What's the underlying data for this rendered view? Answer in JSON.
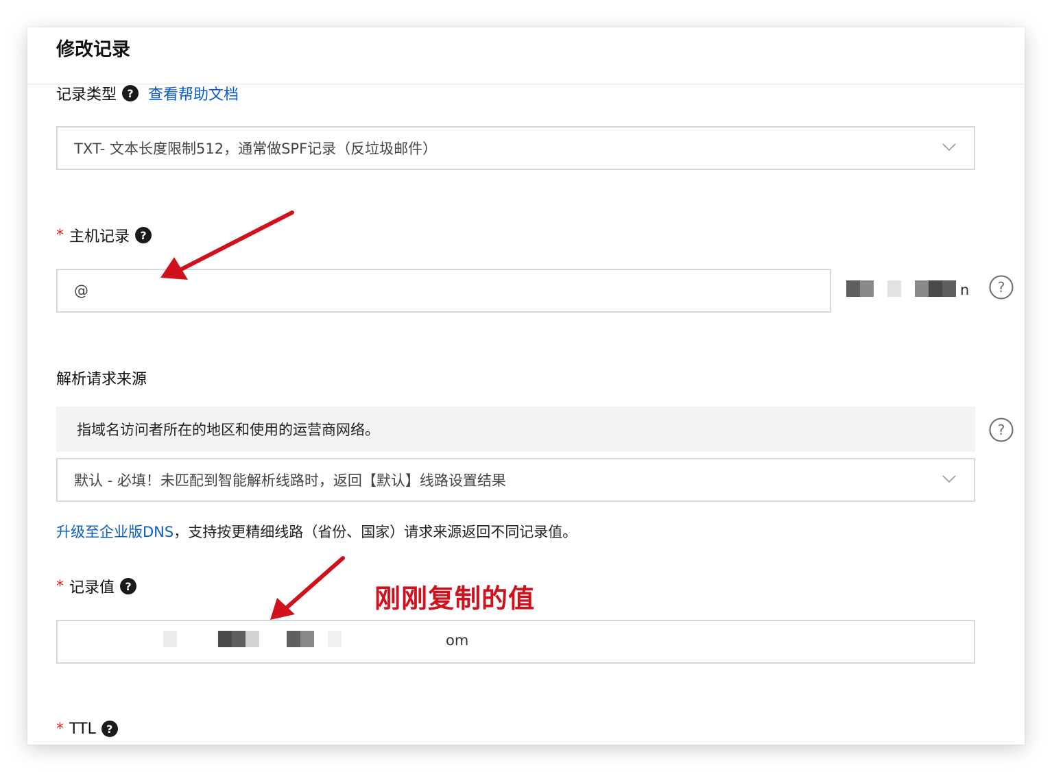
{
  "dialog": {
    "title": "修改记录"
  },
  "record_type": {
    "label": "记录类型",
    "help_link": "查看帮助文档",
    "selected": "TXT- 文本长度限制512，通常做SPF记录（反垃圾邮件）"
  },
  "host_record": {
    "required_mark": "*",
    "label": "主机记录",
    "value": "@",
    "domain_suffix_visible": "n"
  },
  "resolve_source": {
    "label": "解析请求来源",
    "hint": "指域名访问者所在的地区和使用的运营商网络。",
    "selected": "默认 - 必填！未匹配到智能解析线路时，返回【默认】线路设置结果",
    "upgrade_link": "升级至企业版DNS",
    "upgrade_rest": "，支持按更精细线路（省份、国家）请求来源返回不同记录值。"
  },
  "record_value": {
    "required_mark": "*",
    "label": "记录值",
    "visible_tail": "om",
    "annotation": "刚刚复制的值"
  },
  "ttl": {
    "required_mark": "*",
    "label": "TTL"
  },
  "colors": {
    "link": "#0a5cc7",
    "required": "#e1251b",
    "annotation": "#d0101b"
  }
}
